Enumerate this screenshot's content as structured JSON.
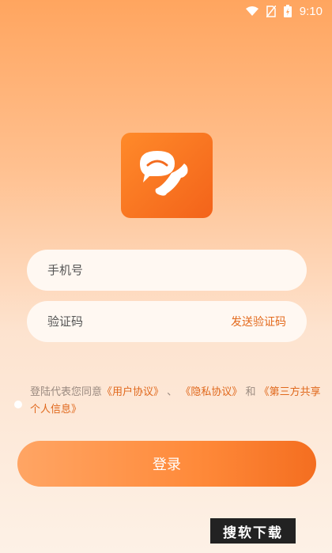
{
  "status_bar": {
    "time": "9:10",
    "icons": [
      "wifi-icon",
      "no-sim-icon",
      "battery-charging-icon"
    ]
  },
  "logo": {
    "icon": "chat-phone-logo-icon"
  },
  "phone_field": {
    "placeholder": "手机号"
  },
  "code_field": {
    "placeholder": "验证码",
    "send_label": "发送验证码"
  },
  "agreement": {
    "prefix": "登陆代表您同意",
    "user_agreement": "《用户协议》",
    "sep1": "、",
    "privacy_agreement": "《隐私协议》",
    "sep2": "和",
    "share_list": "《第三方共享个人信息》"
  },
  "login_button": {
    "label": "登录"
  },
  "watermark": {
    "text": "搜软下载"
  },
  "colors": {
    "accent": "#ff8a3a",
    "link": "#e0681c"
  }
}
